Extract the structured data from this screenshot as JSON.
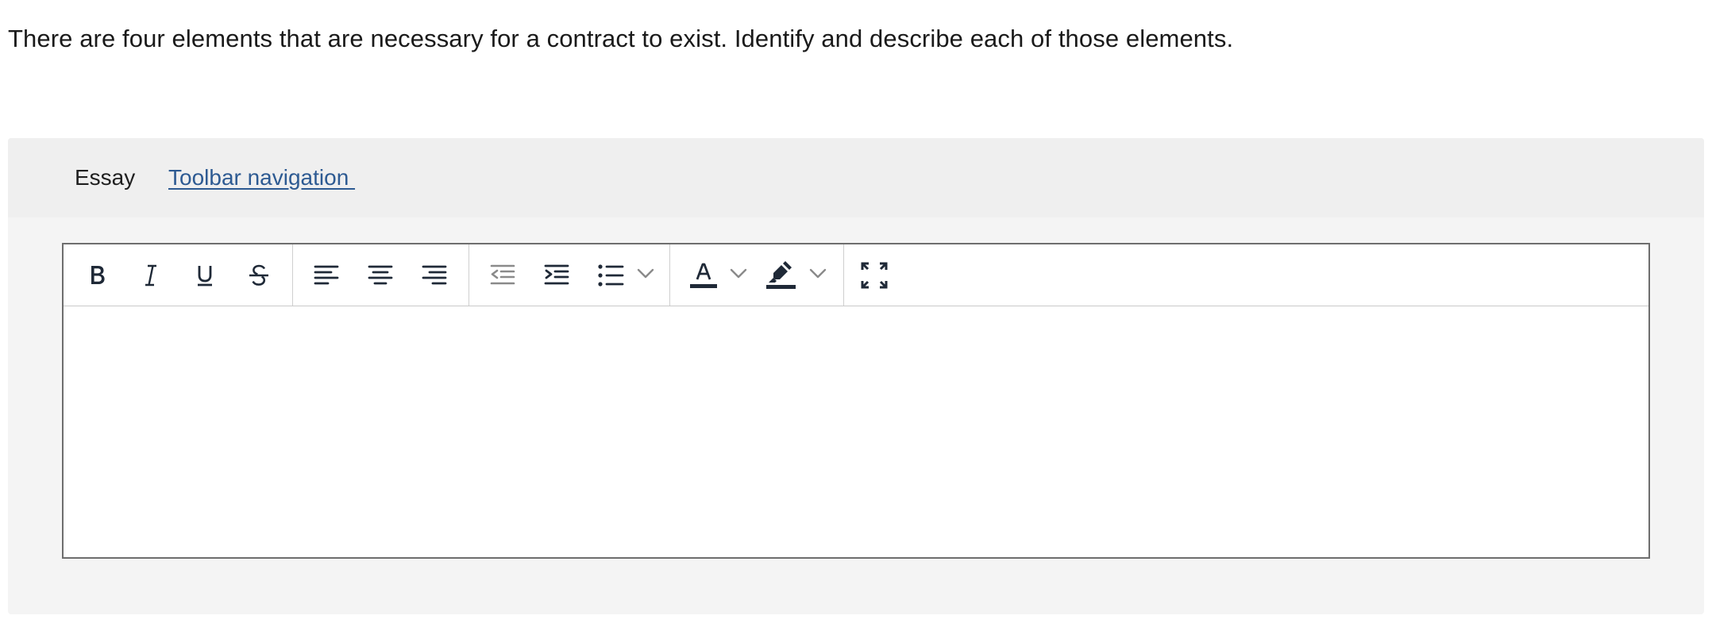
{
  "question": {
    "text": "There are four elements that are necessary for a contract to exist. Identify and describe each of those elements."
  },
  "essay": {
    "label": "Essay",
    "toolbar_navigation_link": "Toolbar navigation "
  },
  "toolbar": {
    "icons": [
      "bold-icon",
      "italic-icon",
      "underline-icon",
      "strikethrough-icon",
      "align-left-icon",
      "align-center-icon",
      "align-right-icon",
      "outdent-icon",
      "indent-icon",
      "bulleted-list-icon",
      "chevron-down-icon",
      "text-color-icon",
      "chevron-down-icon",
      "highlight-color-icon",
      "chevron-down-icon",
      "fullscreen-icon"
    ]
  },
  "editor": {
    "content": ""
  },
  "colors": {
    "icon": "#1f2937",
    "icon_disabled": "#8a8a8a",
    "link": "#2d5a92",
    "panel_bg": "#f4f4f4",
    "header_bg": "#efefef",
    "editor_border": "#6e6e6e"
  }
}
